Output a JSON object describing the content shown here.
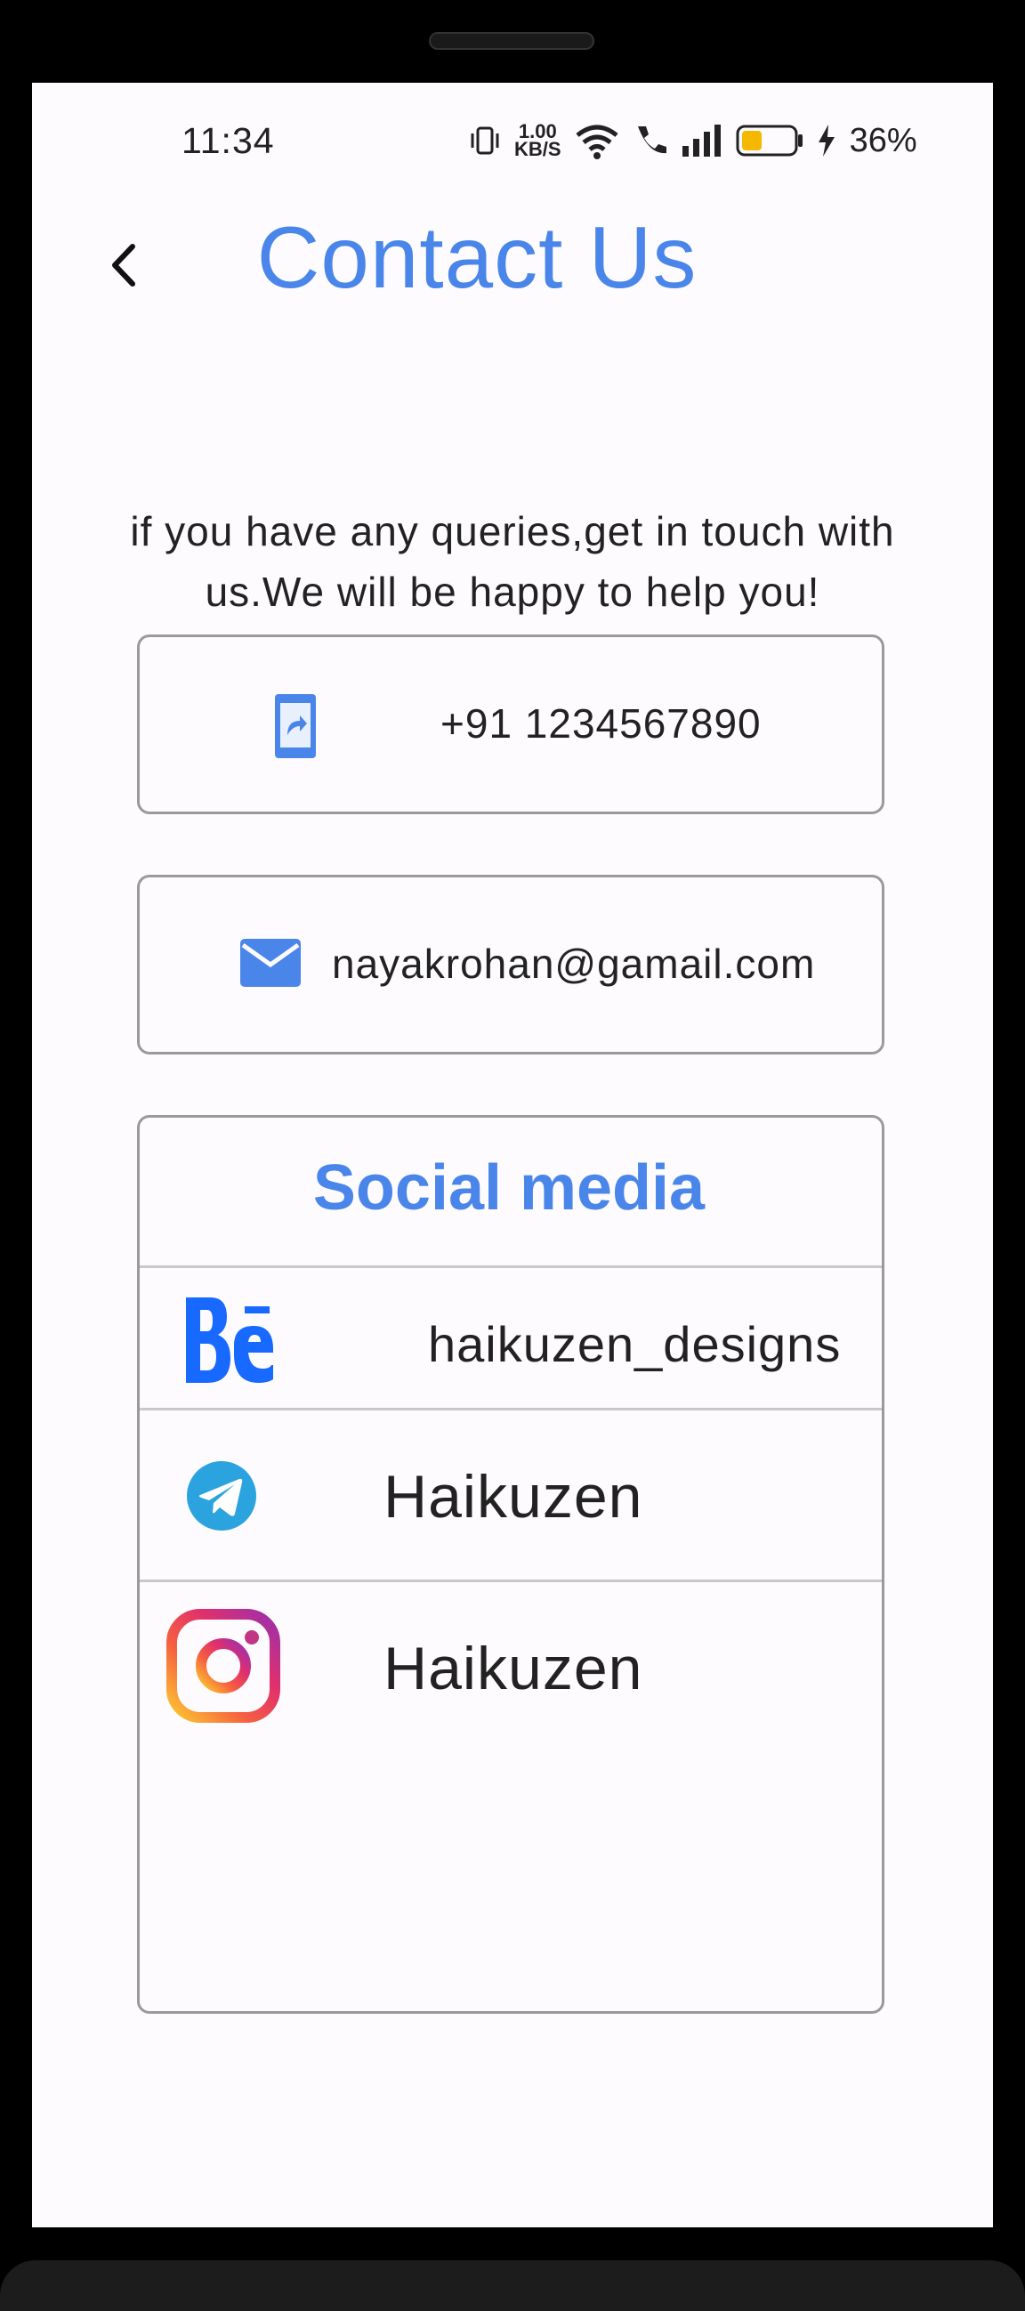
{
  "status_bar": {
    "time": "11:34",
    "network_speed_value": "1.00",
    "network_speed_unit": "KB/S",
    "battery_percent": "36%",
    "icons": [
      "vibrate-icon",
      "wifi-icon",
      "wifi-calling-icon",
      "signal-icon",
      "battery-icon",
      "charging-icon"
    ]
  },
  "header": {
    "back_icon": "chevron-left-icon",
    "title": "Contact Us"
  },
  "intro_text": "if you have any queries,get in touch with us.We will be happy to help you!",
  "contact": {
    "phone": {
      "icon": "phone-forward-icon",
      "value": "+91 1234567890"
    },
    "email": {
      "icon": "mail-icon",
      "value": "nayakrohan@gamail.com"
    }
  },
  "social_media": {
    "title": "Social media",
    "items": [
      {
        "icon": "behance-icon",
        "label": "haikuzen_designs"
      },
      {
        "icon": "telegram-icon",
        "label": "Haikuzen"
      },
      {
        "icon": "instagram-icon",
        "label": "Haikuzen"
      }
    ]
  },
  "colors": {
    "accent": "#4a86ea",
    "background": "#fdfbfe",
    "text": "#222222",
    "border": "#9a9a9a",
    "behance": "#1769ff",
    "telegram": "#2aa3df"
  }
}
